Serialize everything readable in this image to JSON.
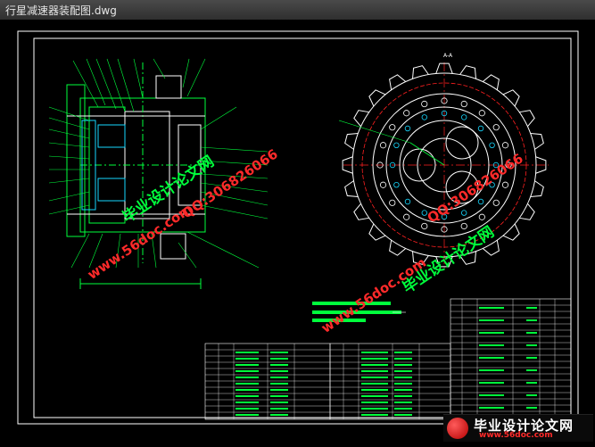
{
  "window": {
    "title": "行星减速器装配图.dwg"
  },
  "section_label": "A-A",
  "colors": {
    "frame": "#ffffff",
    "outline": "#00ff3c",
    "sprocket": "#ffffff",
    "red_line": "#ff2020",
    "cyan": "#16d8ff",
    "watermark_green": "#00ff3c",
    "watermark_red": "#ff2a2a"
  },
  "watermarks": [
    {
      "text": "毕业设计论文网",
      "color": "green"
    },
    {
      "text": "www.56doc.com",
      "color": "red"
    },
    {
      "text": "QQ:306826066",
      "color": "red"
    },
    {
      "text": "毕业设计论文网",
      "color": "green"
    },
    {
      "text": "www.56doc.com",
      "color": "red"
    },
    {
      "text": "QQ:306826066",
      "color": "red"
    }
  ],
  "logo": {
    "title": "毕业设计论文网",
    "url": "www.56doc.com"
  }
}
